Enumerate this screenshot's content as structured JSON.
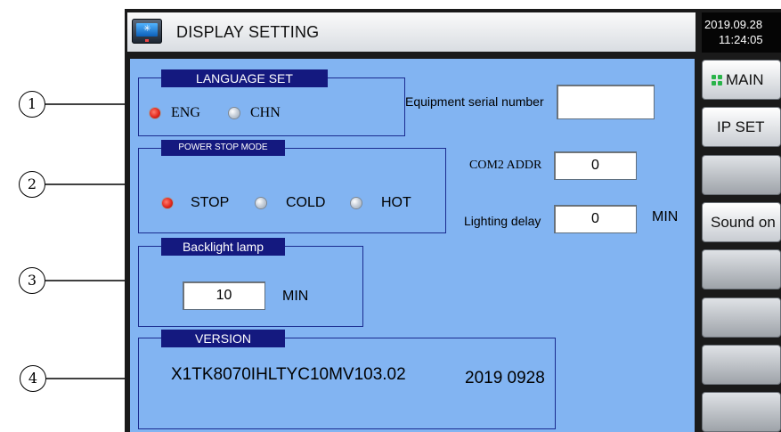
{
  "window": {
    "title": "DISPLAY SETTING",
    "clock": {
      "date": "2019.09.28",
      "time": "11:24:05"
    }
  },
  "callouts": [
    "1",
    "2",
    "3",
    "4"
  ],
  "language": {
    "legend": "LANGUAGE SET",
    "options": [
      {
        "label": "ENG",
        "selected": true
      },
      {
        "label": "CHN",
        "selected": false
      }
    ]
  },
  "serial": {
    "label": "Equipment serial number",
    "value": ""
  },
  "power_stop": {
    "legend": "POWER STOP MODE",
    "options": [
      {
        "label": "STOP",
        "selected": true
      },
      {
        "label": "COLD",
        "selected": false
      },
      {
        "label": "HOT",
        "selected": false
      }
    ]
  },
  "com2": {
    "label": "COM2 ADDR",
    "value": "0"
  },
  "lighting": {
    "label": "Lighting delay",
    "value": "0",
    "unit": "MIN"
  },
  "backlight": {
    "legend": "Backlight lamp",
    "value": "10",
    "unit": "MIN"
  },
  "version": {
    "legend": "VERSION",
    "code": "X1TK8070IHLTYC10MV103.02",
    "date": "2019 0928"
  },
  "sidebar": {
    "items": [
      {
        "label": "MAIN",
        "icon": "grid-icon"
      },
      {
        "label": "IP SET"
      },
      {
        "label": ""
      },
      {
        "label": "Sound on"
      },
      {
        "label": ""
      },
      {
        "label": ""
      },
      {
        "label": ""
      },
      {
        "label": ""
      }
    ]
  },
  "colors": {
    "panel": "#82b4f2",
    "legend": "#14197f",
    "radio_on": "#e2281c",
    "grid_icon": "#2ab44a"
  }
}
